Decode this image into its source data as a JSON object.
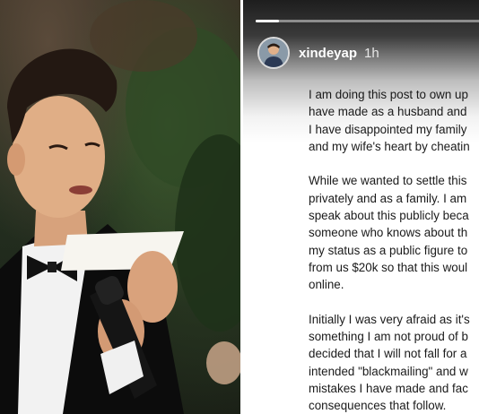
{
  "story": {
    "username": "xindeyap",
    "timestamp": "1h",
    "progress": 0.1,
    "paragraphs": [
      [
        "I am doing this post to own up",
        "have made as a husband and",
        "I have disappointed my family",
        "and my wife's heart by cheatin"
      ],
      [
        "While we wanted to settle this",
        "privately and as a family.  I am",
        "speak about this publicly beca",
        "someone who knows about th",
        "my status as a public figure to",
        "from us $20k so that this woul",
        "online."
      ],
      [
        "Initially I was very afraid as it's",
        "something I am not proud of b",
        "decided that I will not fall for a",
        "intended \"blackmailing\" and w",
        "mistakes I have made and fac",
        "consequences that follow."
      ]
    ]
  },
  "colors": {
    "story_text": "#1a1a1a",
    "username": "#ffffff",
    "progress_fill": "#ffffff"
  },
  "icons": {
    "avatar": "profile-photo"
  }
}
